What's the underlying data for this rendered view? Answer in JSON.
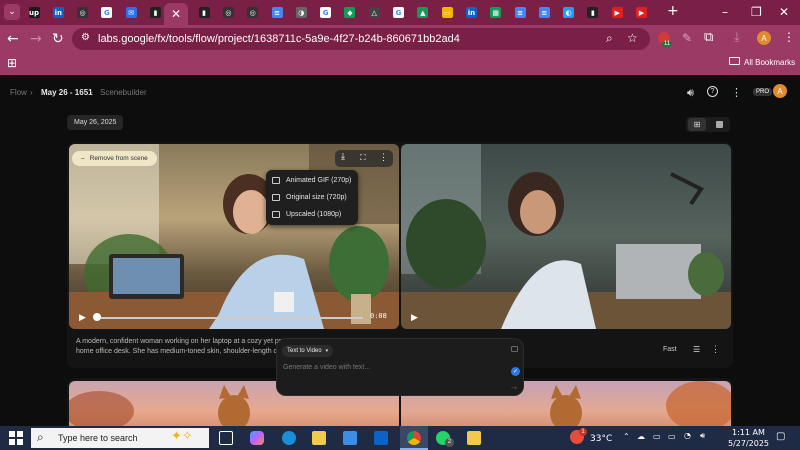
{
  "browser": {
    "url": "labs.google/fx/tools/flow/project/1638711c-5a9e-4f27-b24b-860671bb2ad4",
    "bookmarks_label": "All Bookmarks",
    "profile_initial": "A",
    "extension_badge": "11",
    "tabs": [
      {
        "icon": "up",
        "color": "#1a1a1a"
      },
      {
        "icon": "in",
        "color": "#0a66c2"
      },
      {
        "icon": "◎",
        "color": "#333"
      },
      {
        "icon": "G",
        "color": "#ffffff"
      },
      {
        "icon": "✉",
        "color": "#2f6fe8"
      },
      {
        "icon": "▮",
        "color": "#222"
      },
      {
        "icon": "active",
        "color": "#9b3a64"
      },
      {
        "icon": "▮",
        "color": "#222"
      },
      {
        "icon": "◎",
        "color": "#333"
      },
      {
        "icon": "◎",
        "color": "#333"
      },
      {
        "icon": "≡",
        "color": "#4285f4"
      },
      {
        "icon": "◑",
        "color": "#666"
      },
      {
        "icon": "G",
        "color": "#ffffff"
      },
      {
        "icon": "◆",
        "color": "#0f9d58"
      },
      {
        "icon": "△",
        "color": "#444"
      },
      {
        "icon": "G",
        "color": "#ffffff"
      },
      {
        "icon": "▲",
        "color": "#0f9d58"
      },
      {
        "icon": "▭",
        "color": "#f4b400"
      },
      {
        "icon": "in",
        "color": "#0a66c2"
      },
      {
        "icon": "▦",
        "color": "#0f9d58"
      },
      {
        "icon": "≡",
        "color": "#4285f4"
      },
      {
        "icon": "≡",
        "color": "#4285f4"
      },
      {
        "icon": "◐",
        "color": "#1da1f2"
      },
      {
        "icon": "▮",
        "color": "#222"
      },
      {
        "icon": "▶",
        "color": "#e02020"
      },
      {
        "icon": "▶",
        "color": "#e02020"
      }
    ]
  },
  "app": {
    "breadcrumb_root": "Flow",
    "breadcrumb_project": "May 26 - 1651",
    "breadcrumb_page": "Scenebuilder",
    "plan_badge": "PRO",
    "avatar_initial": "A",
    "date_chip": "May 26, 2025",
    "remove_label": "Remove from scene",
    "video_time": "0:08",
    "download_menu": [
      "Animated GIF (270p)",
      "Original size (720p)",
      "Upscaled (1080p)"
    ],
    "description": "A modern, confident woman working on her laptop at a cozy yet pr home office desk. She has medium-toned skin, shoulder-length da",
    "speed_label": "Fast",
    "prompt_mode": "Text to Video",
    "prompt_placeholder": "Generate a video with text..."
  },
  "taskbar": {
    "search_placeholder": "Type here to search",
    "temperature": "33°C",
    "time": "1:11 AM",
    "date": "5/27/2025",
    "whatsapp_badge": "2",
    "notify_badge": "1"
  }
}
